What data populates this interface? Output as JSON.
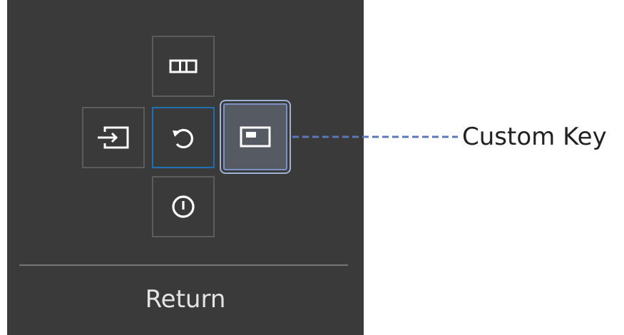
{
  "osd": {
    "keys": {
      "up": {
        "icon": "picture-mode-icon"
      },
      "left": {
        "icon": "source-input-icon"
      },
      "center": {
        "icon": "return-icon"
      },
      "right": {
        "icon": "custom-key-icon"
      },
      "down": {
        "icon": "power-icon"
      }
    },
    "footer_label": "Return"
  },
  "callout": {
    "label": "Custom Key"
  },
  "colors": {
    "panel": "#3a3a3a",
    "key_border": "#5c5c5c",
    "focus_border": "#1f6fb2",
    "highlight_border": "#9fb3d8",
    "callout_line": "#5b78b8"
  }
}
